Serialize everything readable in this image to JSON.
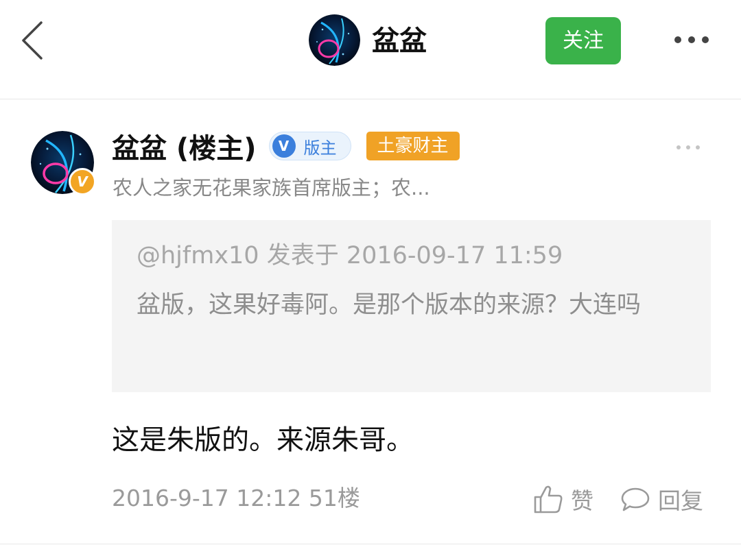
{
  "header": {
    "title": "盆盆",
    "follow_label": "关注",
    "back_icon": "chevron-left-icon",
    "more_icon": "more-horizontal-icon"
  },
  "post": {
    "author_name": "盆盆 (楼主)",
    "moderator_badge": "版主",
    "wealth_badge": "土豪财主",
    "vip_badge": "V",
    "signature": "农人之家无花果家族首席版主；农...",
    "quote": {
      "header": "@hjfmx10 发表于 2016-09-17 11:59",
      "body": "盆版，这果好毒阿。是那个版本的来源？大连吗"
    },
    "content": "这是朱版的。来源朱哥。",
    "meta": "2016-9-17 12:12  51楼",
    "like_label": "赞",
    "reply_label": "回复"
  },
  "colors": {
    "follow_button": "#3ab24a",
    "moderator_blue": "#3b7fdc",
    "wealth_orange": "#f0a226",
    "quote_background": "#f4f4f4"
  }
}
